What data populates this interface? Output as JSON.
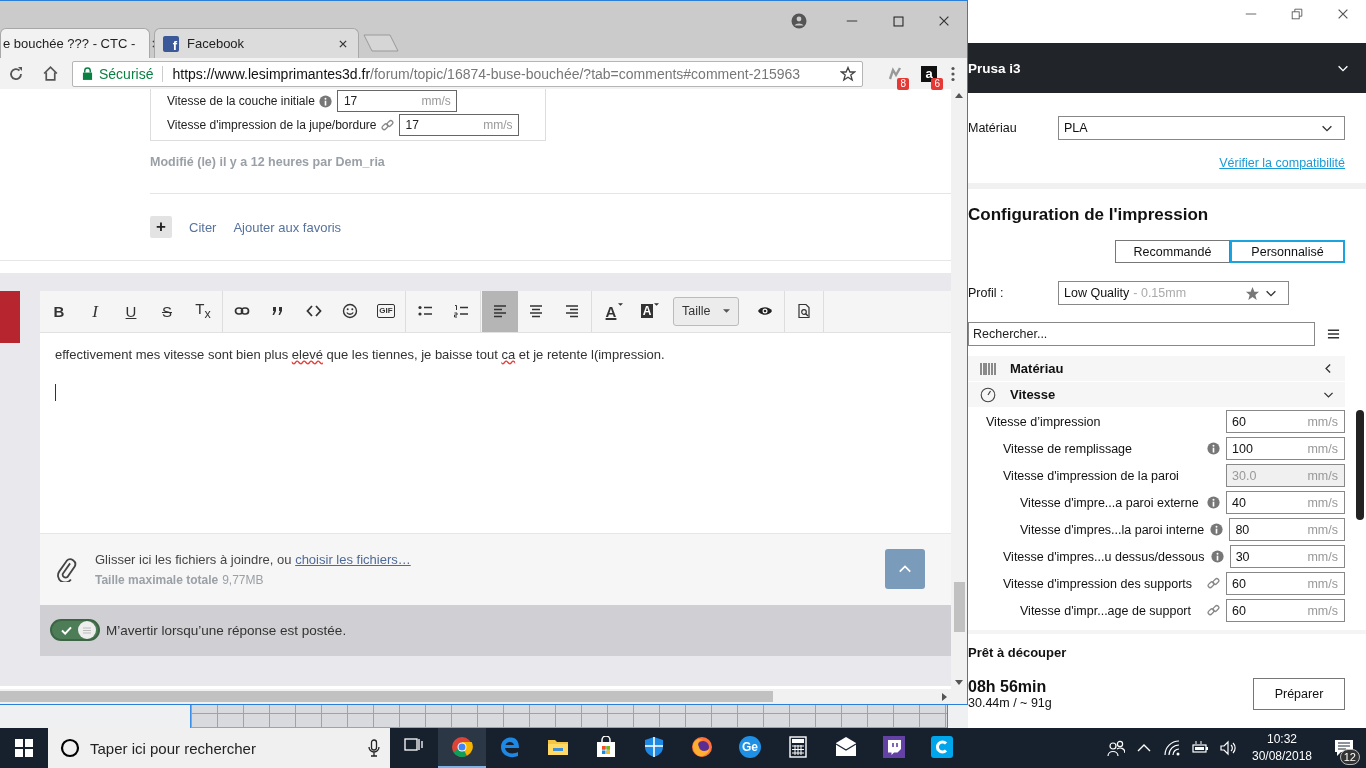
{
  "browser": {
    "tabs": [
      {
        "title": "e bouchée ??? - CTC -",
        "selected": true
      },
      {
        "title": "Facebook",
        "favicon": "f",
        "selected": false
      }
    ],
    "address": {
      "security": "Sécurisé",
      "host": "https://www.lesimprimantes3d.fr",
      "path": "/forum/topic/16874-buse-bouchée/?tab=comments#comment-215963"
    },
    "extensions": [
      {
        "kind": "plugin",
        "badge": "8"
      },
      {
        "kind": "letter",
        "label": "a",
        "badge": "6"
      }
    ],
    "post": {
      "settings_image": [
        {
          "label": "Vitesse de la couche initiale",
          "kind": "info",
          "value": "17",
          "unit": "mm/s"
        },
        {
          "label": "Vitesse d'impression de la jupe/bordure",
          "kind": "link",
          "value": "17",
          "unit": "mm/s"
        }
      ],
      "edited": "Modifié (le) il y a 12 heures par Dem_ria",
      "add": "+",
      "links": [
        "Citer",
        "Ajouter aux favoris"
      ]
    },
    "editor": {
      "toolbar": [
        [
          {
            "kind": "bold",
            "label": "B",
            "selected": false
          },
          {
            "kind": "italic",
            "label": "I",
            "selected": false
          },
          {
            "kind": "underline",
            "label": "U",
            "selected": false
          },
          {
            "kind": "strike",
            "label": "S",
            "selected": false
          },
          {
            "kind": "clear",
            "label": "T$_{x}$",
            "selected": false
          }
        ],
        [
          {
            "kind": "link",
            "selected": false
          },
          {
            "kind": "quote",
            "selected": false
          },
          {
            "kind": "code",
            "selected": false
          },
          {
            "kind": "smiley",
            "selected": false
          },
          {
            "kind": "gif",
            "label": "GIF",
            "selected": false
          }
        ],
        [
          {
            "kind": "bullets",
            "selected": false
          },
          {
            "kind": "numbers",
            "selected": false
          }
        ],
        [
          {
            "kind": "left",
            "selected": true
          },
          {
            "kind": "center",
            "selected": false
          },
          {
            "kind": "right",
            "selected": false
          }
        ],
        [
          {
            "kind": "color",
            "label": "A",
            "selected": false
          },
          {
            "kind": "background",
            "label": "A",
            "selected": false
          },
          {
            "kind": "size",
            "label": "Taille",
            "selected": false
          },
          {
            "kind": "eye",
            "selected": false
          }
        ],
        [
          {
            "kind": "preview",
            "selected": false
          }
        ]
      ],
      "text": [
        {
          "text": "effectivement mes vitesse sont bien plus ",
          "misspelled": false
        },
        {
          "text": "elevé",
          "misspelled": true
        },
        {
          "text": " que les tiennes, je baisse tout ",
          "misspelled": false
        },
        {
          "text": "ca",
          "misspelled": true
        },
        {
          "text": " et je retente l(impression.",
          "misspelled": false
        }
      ],
      "attach": {
        "text": "Glisser ici les fichiers à joindre, ou ",
        "link": "choisir les fichiers…",
        "size_label": "Taille maximale totale",
        "size": "9,77MB"
      },
      "notify": {
        "on": true,
        "label": "M’avertir lorsqu’une réponse est postée."
      }
    }
  },
  "cura": {
    "printer": "Prusa i3",
    "material": {
      "label": "Matériau",
      "value": "PLA"
    },
    "compat_link": "Vérifier la compatibilité",
    "config_title": "Configuration de l'impression",
    "modes": [
      {
        "label": "Recommandé",
        "selected": false
      },
      {
        "label": "Personnalisé",
        "selected": true
      }
    ],
    "profile": {
      "label": "Profil :",
      "name": "Low Quality",
      "detail": "- 0.15mm"
    },
    "search": {
      "placeholder": "Rechercher..."
    },
    "categories": [
      {
        "kind": "material",
        "label": "Matériau",
        "expanded": false
      },
      {
        "kind": "speed",
        "label": "Vitesse",
        "expanded": true,
        "settings": [
          {
            "label": "Vitesse d’impression",
            "value": "60",
            "unit": "mm/s",
            "disabled": false,
            "children": [
              {
                "label": "Vitesse de remplissage",
                "kind": "info",
                "value": "100",
                "unit": "mm/s",
                "disabled": false
              },
              {
                "label": "Vitesse d'impression de la paroi",
                "value": "30.0",
                "unit": "mm/s",
                "disabled": true,
                "children": [
                  {
                    "label": "Vitesse d'impre...a paroi externe",
                    "kind": "info",
                    "value": "40",
                    "unit": "mm/s",
                    "disabled": false
                  },
                  {
                    "label": "Vitesse d'impres...la paroi interne",
                    "kind": "info",
                    "value": "80",
                    "unit": "mm/s",
                    "disabled": false
                  }
                ]
              },
              {
                "label": "Vitesse d'impres...u dessus/dessous",
                "kind": "info",
                "value": "30",
                "unit": "mm/s",
                "disabled": false
              },
              {
                "label": "Vitesse d'impression des supports",
                "kind": "link",
                "value": "60",
                "unit": "mm/s",
                "disabled": false,
                "children": [
                  {
                    "label": "Vitesse d'impr...age de support",
                    "kind": "link",
                    "value": "60",
                    "unit": "mm/s",
                    "disabled": false
                  }
                ]
              }
            ]
          }
        ]
      }
    ],
    "status": "Prêt à découper",
    "time": "08h 56min",
    "usage": "30.44m / ~ 91g",
    "prepare": "Préparer"
  },
  "taskbar": {
    "search": {
      "placeholder": "Taper ici pour rechercher"
    },
    "apps": [
      {
        "kind": "taskview",
        "selected": false
      },
      {
        "kind": "chrome",
        "selected": true
      },
      {
        "kind": "edge",
        "selected": false
      },
      {
        "kind": "folder",
        "selected": false
      },
      {
        "kind": "store",
        "selected": false
      },
      {
        "kind": "shield",
        "selected": false
      },
      {
        "kind": "firefox",
        "selected": false
      },
      {
        "kind": "badge",
        "label": "Ge",
        "selected": false
      },
      {
        "kind": "calculator",
        "selected": false
      },
      {
        "kind": "mail",
        "selected": false
      },
      {
        "kind": "twitch",
        "selected": false
      },
      {
        "kind": "cura",
        "selected": false
      }
    ],
    "time": "10:32",
    "date": "30/08/2018",
    "notifications": "12"
  }
}
